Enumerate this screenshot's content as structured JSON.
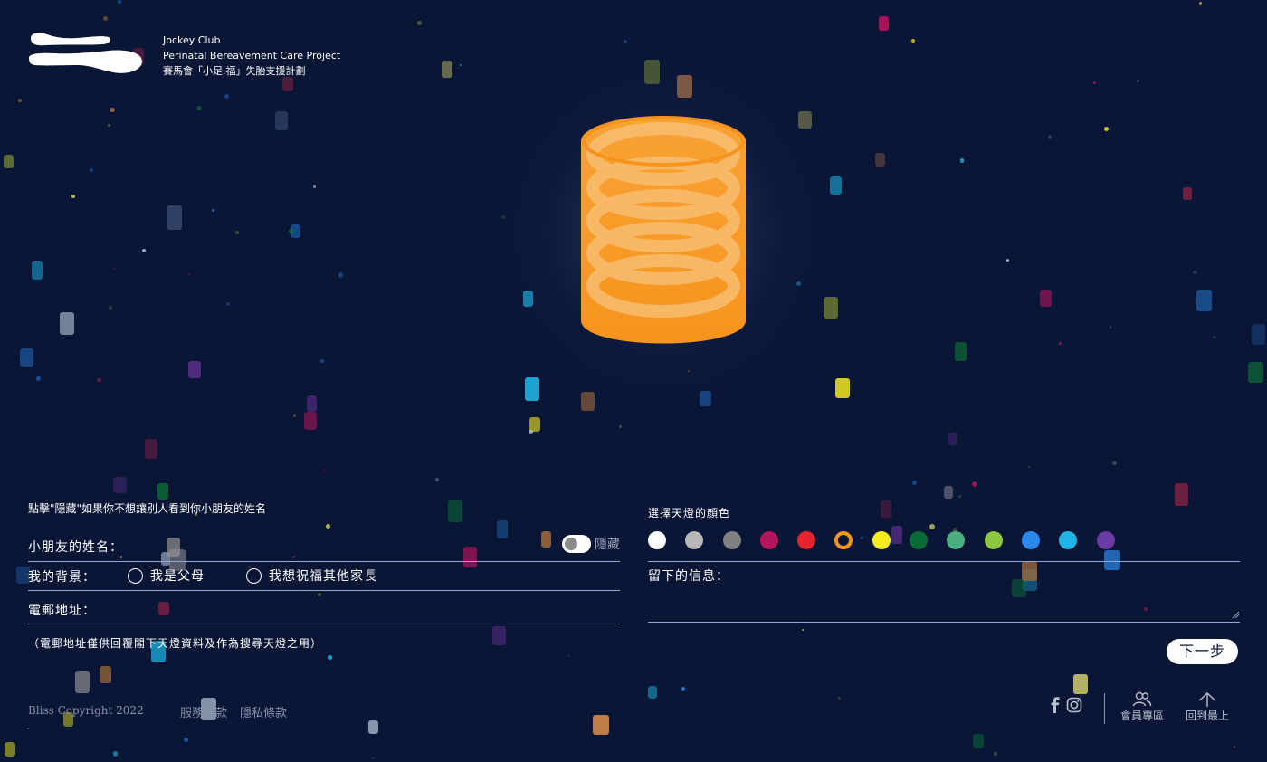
{
  "brand": {
    "line1": "Jockey Club",
    "line2": "Perinatal Bereavement Care Project",
    "line3": "賽馬會「小足.福」失胎支援計劃"
  },
  "form": {
    "hint": "點擊\"隱藏\"如果你不想讓別人看到你小朋友的姓名",
    "name_label": "小朋友的姓名：",
    "hide_label": "隱藏",
    "hide_on": false,
    "background_label": "我的背景：",
    "background_options": [
      "我是父母",
      "我想祝福其他家長"
    ],
    "email_label": "電郵地址：",
    "email_note": "（電郵地址僅供回覆閣下天燈資料及作為搜尋天燈之用）",
    "color_title": "選擇天燈的顏色",
    "colors": [
      "#ffffff",
      "#b8b8b8",
      "#808080",
      "#b5155c",
      "#e8232b",
      "#f7941d",
      "#f7ec1c",
      "#0b6b36",
      "#4caf82",
      "#8dc63f",
      "#2b87e8",
      "#1fb5e5",
      "#6a3ba3"
    ],
    "selected_color": "#f7941d",
    "message_label": "留下的信息：",
    "next_button": "下一步"
  },
  "footer": {
    "copyright": "Bliss Copyright 2022",
    "terms": "服務條款",
    "privacy": "隱私條款",
    "social_icons": [
      "facebook-icon",
      "instagram-icon"
    ],
    "member_label": "會員專區",
    "back_to_top": "回到最上"
  }
}
